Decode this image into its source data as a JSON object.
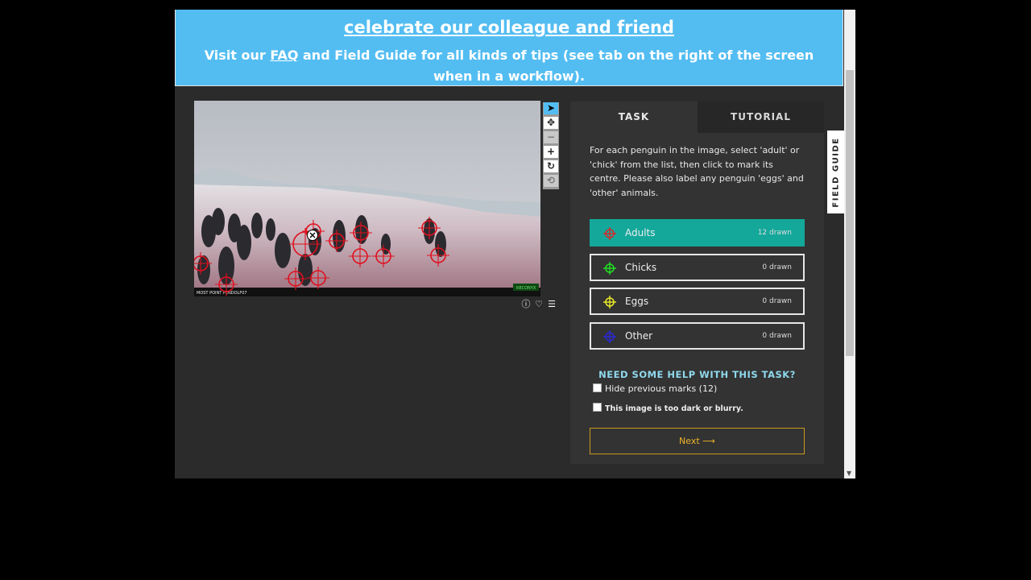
{
  "banner": {
    "line1": "celebrate our colleague and friend",
    "line2_pre": "Visit our ",
    "line2_link": "FAQ",
    "line2_post": " and Field Guide for all kinds of tips (see tab on the right of the screen when in a workflow)."
  },
  "toolbar": {
    "tools": [
      {
        "name": "pointer-tool",
        "glyph": "➤"
      },
      {
        "name": "pan-tool",
        "glyph": "✥"
      },
      {
        "name": "zoom-out-tool",
        "glyph": "−"
      },
      {
        "name": "zoom-in-tool",
        "glyph": "+"
      },
      {
        "name": "rotate-tool",
        "glyph": "↻"
      },
      {
        "name": "reset-tool",
        "glyph": "⟲"
      }
    ]
  },
  "subject": {
    "camera_text": "MOST POINT PENDOLF07",
    "brand_text": "RECONYX",
    "icons": [
      "info-icon",
      "favorite-icon",
      "collections-icon"
    ]
  },
  "task_panel": {
    "tab_task": "TASK",
    "tab_tutorial": "TUTORIAL",
    "instructions": "For each penguin in the image, select 'adult' or 'chick' from the list, then click to mark its centre. Please also label any penguin 'eggs' and 'other' animals.",
    "options": [
      {
        "label": "Adults",
        "count": "12 drawn",
        "color": "#d42a2a",
        "selected": true
      },
      {
        "label": "Chicks",
        "count": "0 drawn",
        "color": "#22dd22",
        "selected": false
      },
      {
        "label": "Eggs",
        "count": "0 drawn",
        "color": "#e6e629",
        "selected": false
      },
      {
        "label": "Other",
        "count": "0 drawn",
        "color": "#2a2ad4",
        "selected": false
      }
    ],
    "help": "NEED SOME HELP WITH THIS TASK?",
    "hide_marks": "Hide previous marks (12)",
    "too_dark": "This image is too dark or blurry.",
    "next": "Next ⟶"
  },
  "field_guide": "FIELD GUIDE",
  "colors": {
    "banner": "#53bdf2",
    "selected_option": "#14a89b",
    "next": "#f0b429",
    "help": "#8fd8ec"
  }
}
